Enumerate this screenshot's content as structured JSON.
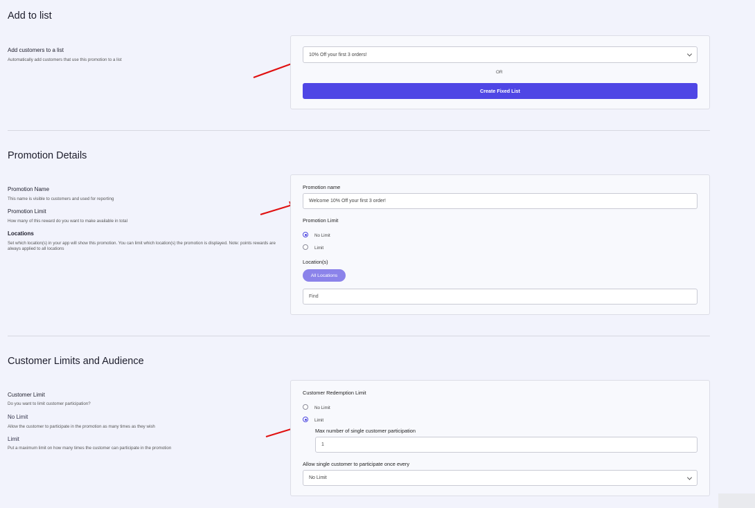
{
  "add_to_list": {
    "title": "Add to list",
    "label": "Add customers to a list",
    "description": "Automatically add customers that use this promotion to a list",
    "select_value": "10% Off your first 3 orders!",
    "or_text": "OR",
    "create_button": "Create Fixed List"
  },
  "promotion_details": {
    "title": "Promotion Details",
    "left": {
      "name_label": "Promotion Name",
      "name_desc": "This name is visible to customers and used for reporting",
      "limit_label": "Promotion Limit",
      "limit_desc": "How many of this reward do you want to make available in total",
      "locations_label": "Locations",
      "locations_desc": "Set which location(s) in your app will show this promotion. You can limit which location(s) the promotion is displayed. Note: points rewards are always applied to all locations"
    },
    "form": {
      "name_label": "Promotion name",
      "name_value": "Welcome 10% Off your first 3 order!",
      "limit_label": "Promotion Limit",
      "limit_options": [
        "No Limit",
        "Limit"
      ],
      "limit_selected": "No Limit",
      "locations_label": "Location(s)",
      "all_locations": "All Locations",
      "find_placeholder": "Find"
    }
  },
  "customer_limits": {
    "title": "Customer Limits and Audience",
    "left": {
      "limit_label": "Customer Limit",
      "limit_desc": "Do you want to limit customer participation?",
      "no_limit_label": "No Limit",
      "no_limit_desc": "Allow the customer to participate in the promotion as many times as they wish",
      "limit2_label": "Limit",
      "limit2_desc": "Put a maximum limit on how many times the customer can participate in the promotion"
    },
    "form": {
      "redemption_label": "Customer Redemption Limit",
      "options": [
        "No Limit",
        "Limit"
      ],
      "selected": "Limit",
      "max_label": "Max number of single customer participation",
      "max_value": "1",
      "frequency_label": "Allow single customer to participate once every",
      "frequency_value": "No Limit"
    }
  },
  "colors": {
    "primary": "#4f46e5",
    "pill": "#8b83ea",
    "arrow": "#e01010",
    "background": "#f2f3fc"
  }
}
